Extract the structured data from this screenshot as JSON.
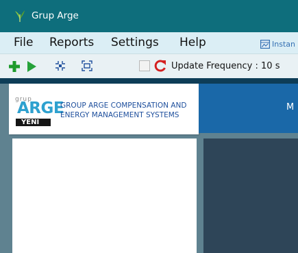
{
  "window": {
    "title": "Grup Arge",
    "icon": "leaf-logo-icon"
  },
  "menubar": {
    "items": [
      "File",
      "Reports",
      "Settings",
      "Help"
    ],
    "instant_label": "Instan",
    "instant_icon": "chart-window-icon"
  },
  "toolbar": {
    "icons": [
      "add-icon",
      "play-icon",
      "shrink-frame-icon",
      "expand-frame-icon"
    ],
    "refresh_icon": "refresh-icon",
    "update_label": "Update Frequency  :  10 s",
    "update_checkbox_checked": false
  },
  "logo": {
    "small_text": "grup",
    "big_text": "ARGE",
    "badge": "YENİ",
    "tagline": "GROUP ARGE COMPENSATION AND ENERGY MANAGEMENT SYSTEMS"
  },
  "header": {
    "partial_text": "M"
  },
  "colors": {
    "titlebar": "#0e6e7c",
    "menubar": "#dbeef5",
    "header_blue": "#1a68a8",
    "content_dark": "#2e4558",
    "accent_green": "#1f9b2d",
    "accent_red": "#d42020"
  }
}
